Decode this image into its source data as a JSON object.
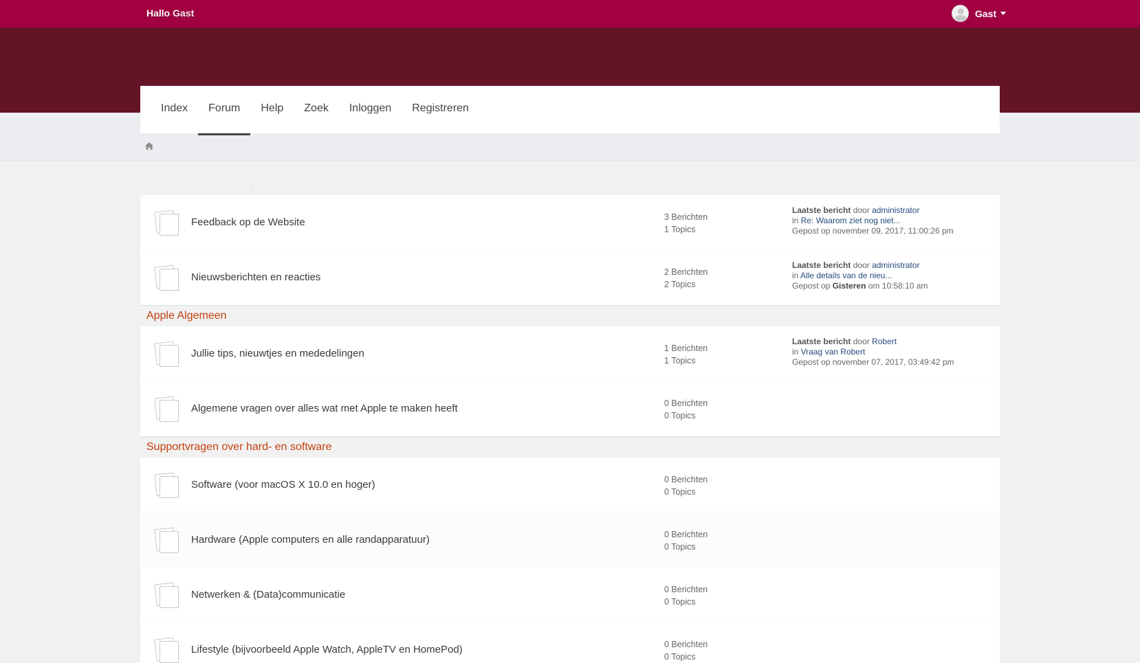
{
  "header": {
    "greeting_prefix": "Hallo",
    "greeting_user": "Gast",
    "user_menu_label": "Gast"
  },
  "nav": {
    "items": [
      "Index",
      "Forum",
      "Help",
      "Zoek",
      "Inloggen",
      "Registreren"
    ],
    "active": "Forum"
  },
  "breadcrumb": {
    "icon": "home-icon"
  },
  "labels": {
    "last_post": "Laatste bericht",
    "by": "door",
    "in": "in",
    "posted_on": "Gepost op",
    "on": "om"
  },
  "boards": {
    "feedback": {
      "name": "Feedback op de  Website",
      "posts": "3 Berichten",
      "topics": "1 Topics",
      "last_author": "administrator",
      "last_topic": "Re: Waarom ziet nog niet...",
      "last_date": "november 09, 2017, 11:00:26 pm"
    },
    "nieuws": {
      "name": "Nieuwsberichten en reacties",
      "posts": "2 Berichten",
      "topics": "2 Topics",
      "last_author": "administrator",
      "last_topic": "Alle details van de nieu...",
      "last_date_strong": "Gisteren",
      "last_time": "10:58:10 am"
    },
    "tips": {
      "name": "Jullie tips, nieuwtjes en mededelingen",
      "posts": "1 Berichten",
      "topics": "1 Topics",
      "last_author": "Robert",
      "last_topic": "Vraag van Robert",
      "last_date": "november 07, 2017, 03:49:42 pm"
    },
    "algemeen": {
      "name": "Algemene vragen over alles wat met Apple te maken heeft",
      "posts": "0 Berichten",
      "topics": "0 Topics"
    },
    "software": {
      "name": "Software (voor macOS X 10.0 en hoger)",
      "posts": "0 Berichten",
      "topics": "0 Topics"
    },
    "hardware": {
      "name": "Hardware (Apple computers en alle randapparatuur)",
      "posts": "0 Berichten",
      "topics": "0 Topics"
    },
    "netwerken": {
      "name": "Netwerken & (Data)communicatie",
      "posts": "0 Berichten",
      "topics": "0 Topics"
    },
    "lifestyle": {
      "name": "Lifestyle (bijvoorbeeld Apple Watch, AppleTV en HomePod)",
      "posts": "0 Berichten",
      "topics": "0 Topics"
    }
  },
  "categories": {
    "apple_algemeen": "Apple Algemeen",
    "support": "Supportvragen over hard- en software"
  },
  "colors": {
    "topbar": "#a10042",
    "banner": "#641427",
    "category_title": "#c2410c",
    "link": "#264a7c"
  }
}
